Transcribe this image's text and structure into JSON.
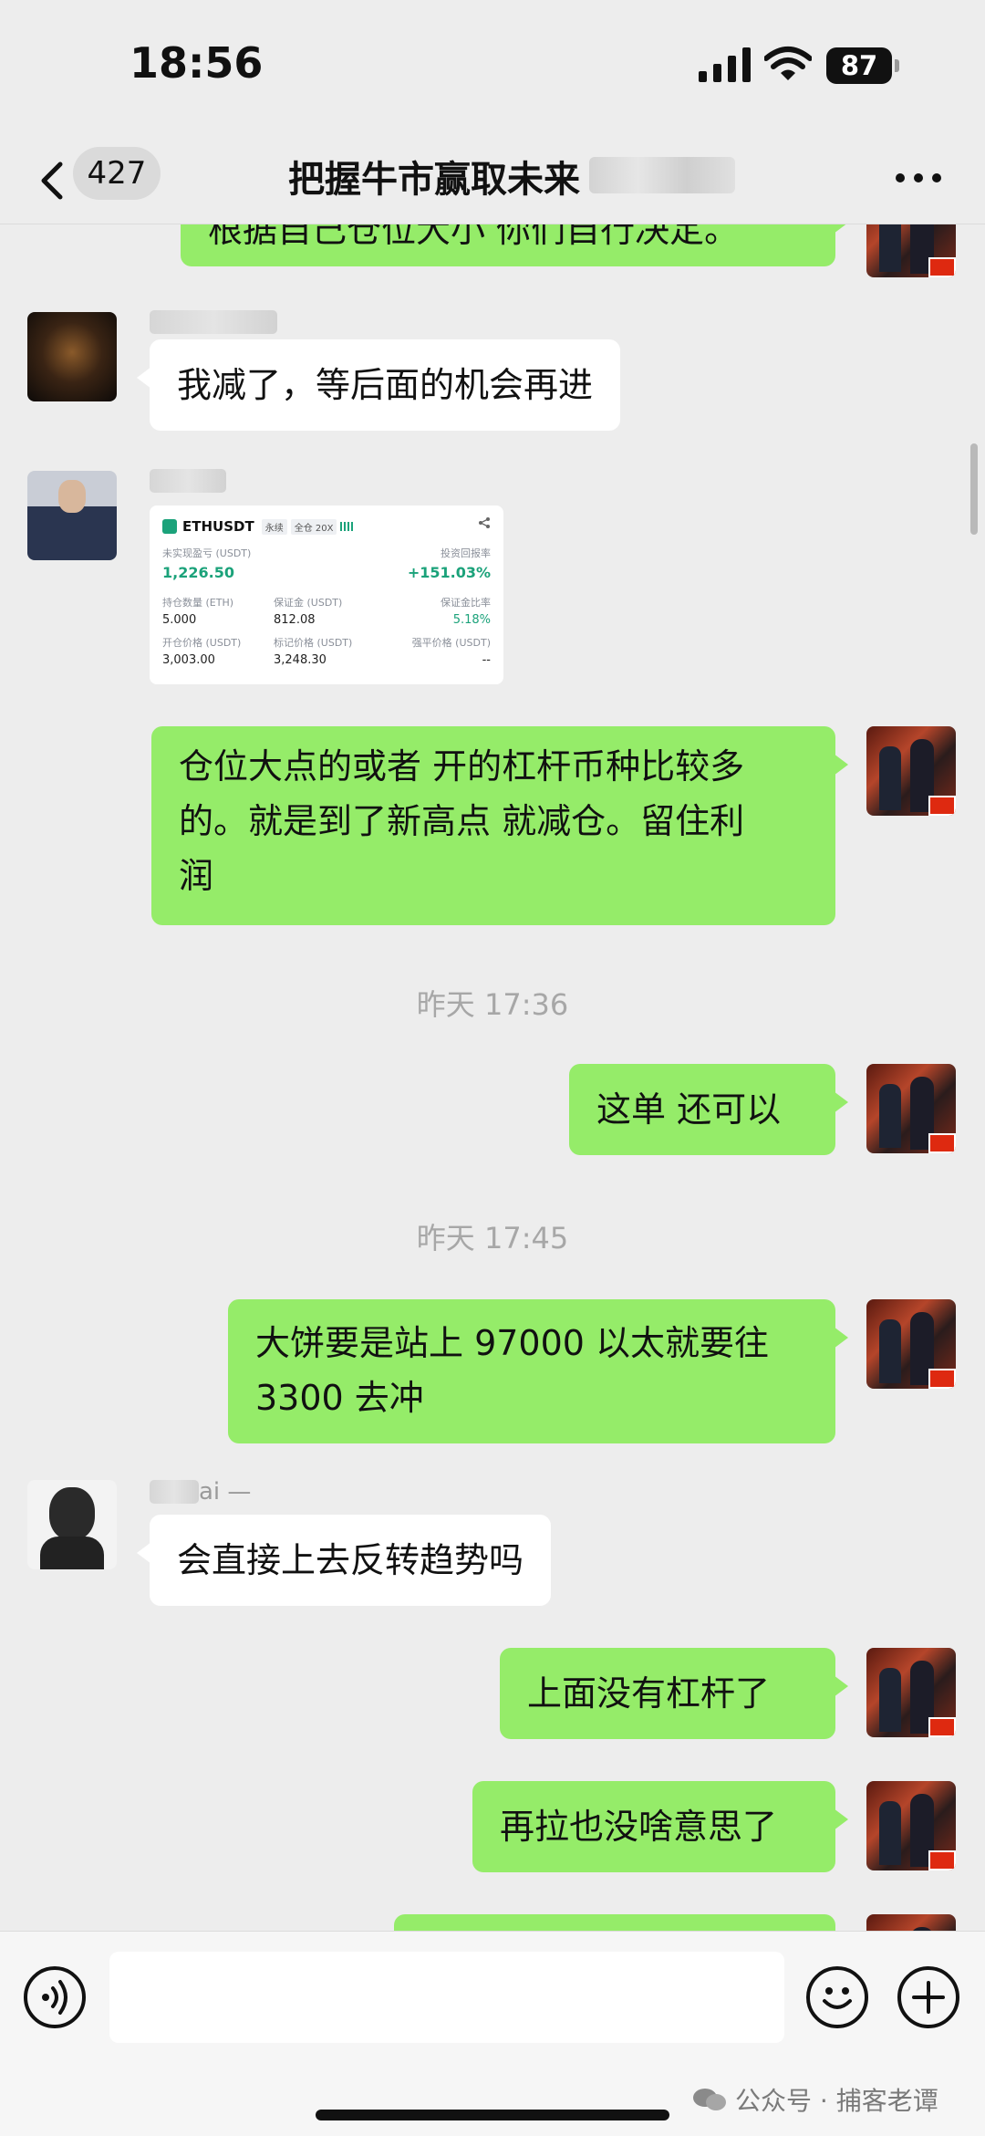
{
  "status_bar": {
    "time": "18:56",
    "battery": "87"
  },
  "nav": {
    "unread_count": "427",
    "title": "把握牛市赢取未来"
  },
  "messages": {
    "m0": "根据自己仓位大小 你们自行决定。",
    "m1": "我减了，等后面的机会再进",
    "m3": "仓位大点的或者 开的杠杆币种比较多\n的。就是到了新高点 就减仓。留住利\n润",
    "ts1": "昨天 17:36",
    "m4": "这单 还可以",
    "ts2": "昨天 17:45",
    "m5": "大饼要是站上 97000 以太就要往\n3300 去冲",
    "m6": "会直接上去反转趋势吗",
    "m7": "上面没有杠杆了",
    "m8": "再拉也没啥意思了"
  },
  "nicknames": {
    "n3_suffix": "ai —"
  },
  "position_card": {
    "symbol": "ETHUSDT",
    "tag_perp": "永续",
    "tag_margin": "全仓 20X",
    "unrealized_pnl_label": "未实现盈亏 (USDT)",
    "unrealized_pnl_value": "1,226.50",
    "roi_label": "投资回报率",
    "roi_value": "+151.03%",
    "size_label": "持仓数量 (ETH)",
    "size_value": "5.000",
    "margin_label": "保证金 (USDT)",
    "margin_value": "812.08",
    "margin_ratio_label": "保证金比率",
    "margin_ratio_value": "5.18%",
    "entry_label": "开仓价格 (USDT)",
    "entry_value": "3,003.00",
    "mark_label": "标记价格 (USDT)",
    "mark_value": "3,248.30",
    "liq_label": "强平价格 (USDT)",
    "liq_value": "--"
  },
  "watermark": "公众号 · 捕客老谭",
  "icons": {
    "back": "back-icon",
    "more": "more-icon",
    "voice": "voice-icon",
    "emoji": "emoji-icon",
    "plus": "plus-icon",
    "wechat": "wechat-icon"
  },
  "colors": {
    "bubble_self": "#95ec69",
    "bubble_other": "#ffffff",
    "background": "#ededed"
  }
}
